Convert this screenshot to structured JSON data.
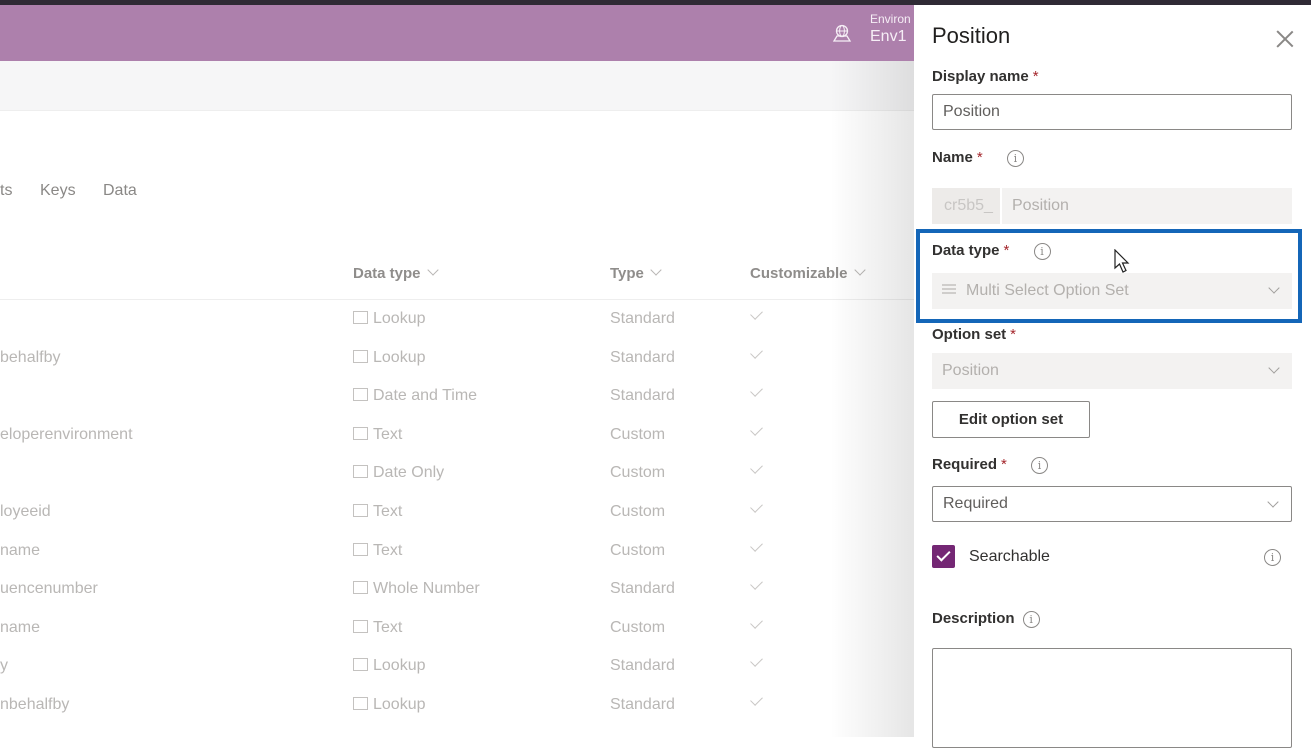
{
  "header": {
    "environment_label": "Environ",
    "environment_value": "Env1",
    "environment_icon": "globe-icon"
  },
  "tabs": [
    {
      "label": "ts"
    },
    {
      "label": "Keys"
    },
    {
      "label": "Data"
    }
  ],
  "grid": {
    "columns": [
      {
        "label": "Data type"
      },
      {
        "label": "Type"
      },
      {
        "label": "Customizable"
      }
    ],
    "rows": [
      {
        "name": "",
        "data_type": "Lookup",
        "type": "Standard",
        "customizable": true
      },
      {
        "name": "behalfby",
        "data_type": "Lookup",
        "type": "Standard",
        "customizable": true
      },
      {
        "name": "",
        "data_type": "Date and Time",
        "type": "Standard",
        "customizable": true
      },
      {
        "name": "eloperenvironment",
        "data_type": "Text",
        "type": "Custom",
        "customizable": true
      },
      {
        "name": "",
        "data_type": "Date Only",
        "type": "Custom",
        "customizable": true
      },
      {
        "name": "loyeeid",
        "data_type": "Text",
        "type": "Custom",
        "customizable": true
      },
      {
        "name": "name",
        "data_type": "Text",
        "type": "Custom",
        "customizable": true
      },
      {
        "name": "uencenumber",
        "data_type": "Whole Number",
        "type": "Standard",
        "customizable": true
      },
      {
        "name": "name",
        "data_type": "Text",
        "type": "Custom",
        "customizable": true
      },
      {
        "name": "y",
        "data_type": "Lookup",
        "type": "Standard",
        "customizable": true
      },
      {
        "name": "nbehalfby",
        "data_type": "Lookup",
        "type": "Standard",
        "customizable": true
      }
    ]
  },
  "panel": {
    "title": "Position",
    "display_name": {
      "label": "Display name",
      "required_mark": "*",
      "value": "Position"
    },
    "name": {
      "label": "Name",
      "required_mark": "*",
      "prefix": "cr5b5_",
      "value": "Position"
    },
    "data_type": {
      "label": "Data type",
      "required_mark": "*",
      "value": "Multi Select Option Set"
    },
    "option_set": {
      "label": "Option set",
      "required_mark": "*",
      "value": "Position"
    },
    "edit_option_set_button": "Edit option set",
    "required": {
      "label": "Required",
      "required_mark": "*",
      "value": "Required"
    },
    "searchable": {
      "label": "Searchable",
      "checked": true
    },
    "description": {
      "label": "Description",
      "value": ""
    },
    "info_glyph": "i",
    "accent_color": "#742774",
    "highlight_color": "#1466b8"
  }
}
